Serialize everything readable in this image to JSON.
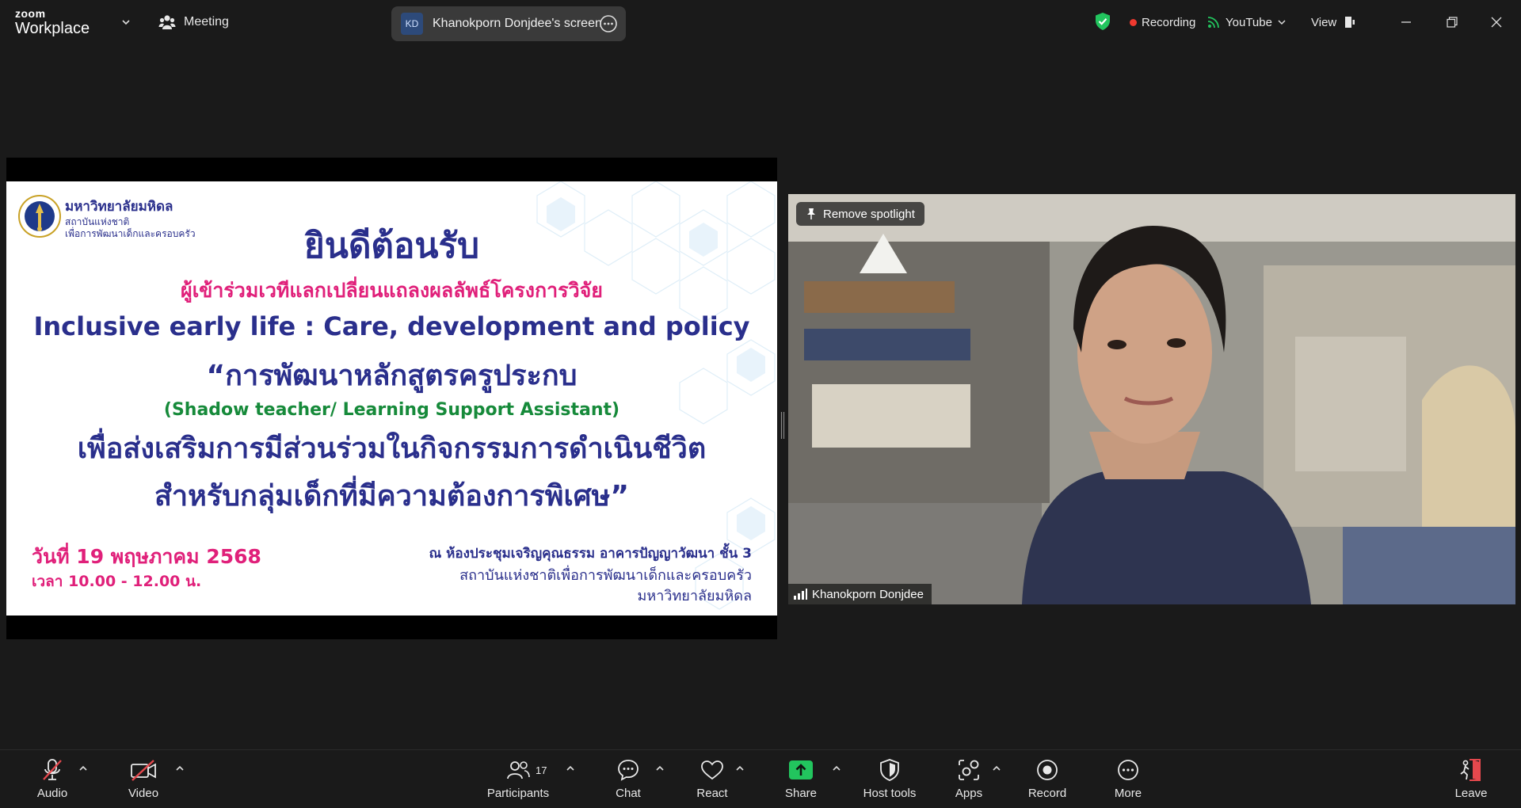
{
  "app": {
    "brand_top": "zoom",
    "brand_bottom": "Workplace",
    "meeting_label": "Meeting",
    "share": {
      "initials": "KD",
      "label": "Khanokporn Donjdee's screen"
    },
    "recording_label": "Recording",
    "youtube_label": "YouTube",
    "view_label": "View"
  },
  "slide": {
    "university": "มหาวิทยาลัยมหิดล",
    "institute_line1": "สถาบันแห่งชาติ",
    "institute_line2": "เพื่อการพัฒนาเด็กและครอบครัว",
    "welcome": "ยินดีต้อนรับ",
    "subtitle": "ผู้เข้าร่วมเวทีแลกเปลี่ยนแถลงผลลัพธ์โครงการวิจัย",
    "english_title": "Inclusive early life : Care, development and policy",
    "thai_title_1": "“การพัฒนาหลักสูตรครูประกบ",
    "english_sub": "(Shadow teacher/ Learning Support Assistant)",
    "thai_title_2": "เพื่อส่งเสริมการมีส่วนร่วมในกิจกรรมการดำเนินชีวิต",
    "thai_title_3": "สำหรับกลุ่มเด็กที่มีความต้องการพิเศษ”",
    "date": "วันที่ 19 พฤษภาคม 2568",
    "time": "เวลา 10.00 - 12.00 น.",
    "venue": "ณ ห้องประชุมเจริญคุณธรรม อาคารปัญญาวัฒนา ชั้น 3",
    "institute_full": "สถาบันแห่งชาติเพื่อการพัฒนาเด็กและครอบครัว",
    "university_bottom": "มหาวิทยาลัยมหิดล"
  },
  "video": {
    "remove_spotlight": "Remove spotlight",
    "participant_name": "Khanokporn Donjdee"
  },
  "toolbar": {
    "audio": "Audio",
    "video": "Video",
    "participants": "Participants",
    "participants_count": "17",
    "chat": "Chat",
    "react": "React",
    "share": "Share",
    "host_tools": "Host tools",
    "apps": "Apps",
    "record": "Record",
    "more": "More",
    "leave": "Leave"
  },
  "colors": {
    "background": "#1a1a1a",
    "share_green": "#22c55e",
    "recording_red": "#f0392f",
    "leave_red": "#e5484d",
    "slide_navy": "#2a2f8c",
    "slide_pink": "#e0207a",
    "slide_green": "#168a3a"
  }
}
